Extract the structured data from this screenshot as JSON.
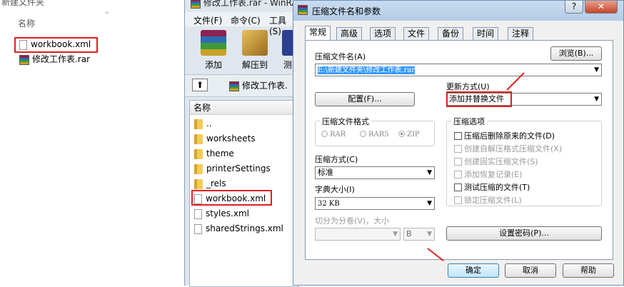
{
  "explorer": {
    "title": "新建文件夹",
    "column_name": "名称",
    "files": [
      {
        "name": "workbook.xml",
        "type": "xml"
      },
      {
        "name": "修改工作表.rar",
        "type": "rar"
      }
    ]
  },
  "winrar": {
    "title": "修改工作表.rar - WinRAR",
    "menu": [
      "文件(F)",
      "命令(C)",
      "工具(S)"
    ],
    "toolbar": [
      "添加",
      "解压到",
      "测"
    ],
    "path": "修改工作表.",
    "column_name": "名称",
    "files": [
      {
        "name": "..",
        "type": "folder"
      },
      {
        "name": "worksheets",
        "type": "folder"
      },
      {
        "name": "theme",
        "type": "folder"
      },
      {
        "name": "printerSettings",
        "type": "folder"
      },
      {
        "name": "_rels",
        "type": "folder"
      },
      {
        "name": "workbook.xml",
        "type": "xml"
      },
      {
        "name": "styles.xml",
        "type": "xml"
      },
      {
        "name": "sharedStrings.xml",
        "type": "xml"
      }
    ]
  },
  "dialog": {
    "title": "压缩文件名和参数",
    "help_btn": "?",
    "close_btn": "✕",
    "tabs": [
      "常规",
      "高级",
      "选项",
      "文件",
      "备份",
      "时间",
      "注释"
    ],
    "archive_name_label": "压缩文件名(A)",
    "browse_btn": "浏览(B)...",
    "archive_name_value": "E:\\新建文件夹\\修改工作表.rar",
    "update_mode_label": "更新方式(U)",
    "update_mode_value": "添加并替换文件",
    "profiles_btn": "配置(F)...",
    "format_group": "压缩文件格式",
    "formats": [
      {
        "label": "RAR",
        "selected": false
      },
      {
        "label": "RAR5",
        "selected": false
      },
      {
        "label": "ZIP",
        "selected": true
      }
    ],
    "options_group": "压缩选项",
    "options": [
      {
        "label": "压缩后删除原来的文件(D)",
        "enabled": true
      },
      {
        "label": "创建自解压格式压缩文件(X)",
        "enabled": false
      },
      {
        "label": "创建固实压缩文件(S)",
        "enabled": false
      },
      {
        "label": "添加恢复记录(E)",
        "enabled": false
      },
      {
        "label": "测试压缩的文件(T)",
        "enabled": true
      },
      {
        "label": "锁定压缩文件(L)",
        "enabled": false
      }
    ],
    "method_label": "压缩方式(C)",
    "method_value": "标准",
    "dict_label": "字典大小(I)",
    "dict_value": "32 KB",
    "split_label": "切分为分卷(V)，大小",
    "split_unit": "B",
    "password_btn": "设置密码(P)...",
    "ok_btn": "确定",
    "cancel_btn": "取消",
    "help_text_btn": "帮助"
  },
  "colors": {
    "highlight": "#e02020",
    "selection": "#3399ff"
  }
}
